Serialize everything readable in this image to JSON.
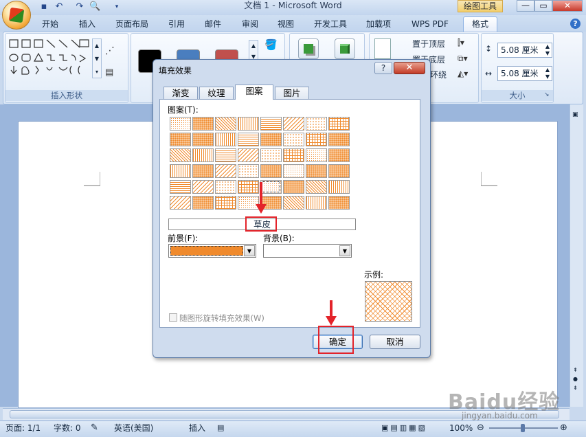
{
  "title_bar": {
    "title": "文档 1 - Microsoft Word",
    "contextual_tab": "绘图工具",
    "window_buttons": {
      "minimize": "—",
      "restore": "▭",
      "close": "✕"
    },
    "qat_icons": [
      "save-icon",
      "undo-icon",
      "redo-icon",
      "print-preview-icon",
      "customize-icon"
    ]
  },
  "ribbon": {
    "tabs": [
      "开始",
      "插入",
      "页面布局",
      "引用",
      "邮件",
      "审阅",
      "视图",
      "开发工具",
      "加载项",
      "WPS PDF",
      "格式"
    ],
    "active_tab": "格式",
    "groups": {
      "insert_shapes_label": "插入形状",
      "size_label": "大小",
      "arrange_items": [
        "置于顶层",
        "置于底层",
        "环绕"
      ],
      "height_value": "5.08 厘米",
      "width_value": "5.08 厘米"
    },
    "style_colors": [
      "#000000",
      "#4a7ebf",
      "#c0504d"
    ]
  },
  "dialog": {
    "title": "填充效果",
    "help_glyph": "?",
    "close_glyph": "✕",
    "tabs": [
      "渐变",
      "纹理",
      "图案",
      "图片"
    ],
    "active_tab": "图案",
    "pattern_label": "图案(T):",
    "pattern_rows": 6,
    "pattern_cols": 8,
    "pattern_color": "#f08a2c",
    "selected_pattern_name": "草皮",
    "foreground_label": "前景(F):",
    "foreground_color": "#f08a2c",
    "background_label": "背景(B):",
    "background_color": "#ffffff",
    "sample_label": "示例:",
    "rotate_checkbox_label": "随图形旋转填充效果(W)",
    "rotate_checked": false,
    "ok_label": "确定",
    "cancel_label": "取消",
    "highlight_color": "#e3232a"
  },
  "status_bar": {
    "page": "页面: 1/1",
    "words": "字数: 0",
    "language": "英语(美国)",
    "mode": "插入",
    "zoom": "100%"
  },
  "watermark": {
    "brand": "Baidu经验",
    "url": "jingyan.baidu.com"
  }
}
